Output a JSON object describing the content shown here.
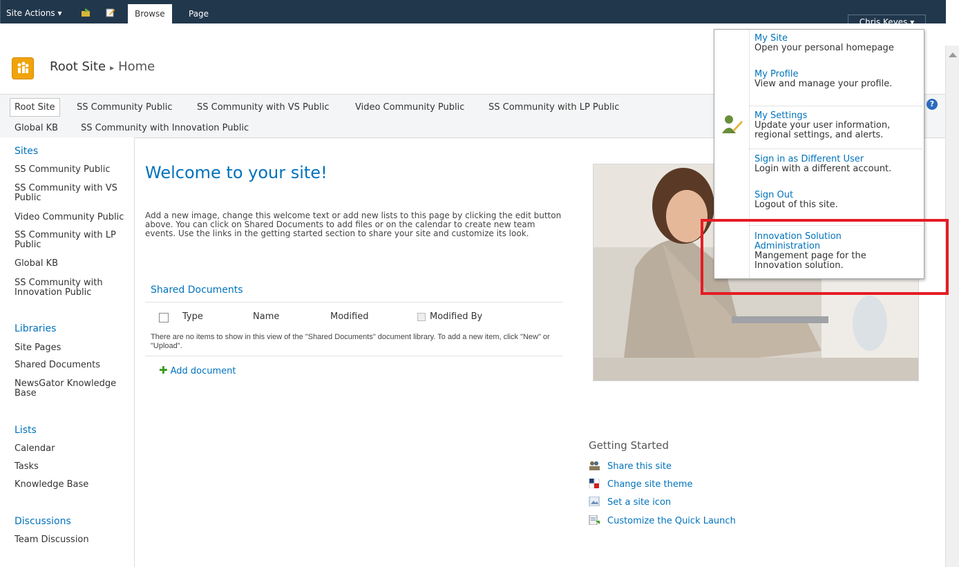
{
  "ribbon": {
    "site_actions": "Site Actions ▾",
    "tabs": [
      {
        "label": "Browse"
      },
      {
        "label": "Page"
      }
    ],
    "user": "Chris Keyes ▾"
  },
  "header": {
    "site": "Root Site",
    "current": "Home"
  },
  "topnav": {
    "row1": [
      "Root Site",
      "SS Community Public",
      "SS Community with VS Public",
      "Video Community Public",
      "SS Community with LP Public"
    ],
    "row2": [
      "Global KB",
      "SS Community with Innovation Public"
    ]
  },
  "quicklaunch": {
    "sites_heading": "Sites",
    "sites": [
      "SS Community Public",
      "SS Community with VS Public",
      "Video Community Public",
      "SS Community with LP Public",
      "Global KB",
      "SS Community with Innovation Public"
    ],
    "libraries_heading": "Libraries",
    "libraries": [
      "Site Pages",
      "Shared Documents",
      "NewsGator Knowledge Base"
    ],
    "lists_heading": "Lists",
    "lists": [
      "Calendar",
      "Tasks",
      "Knowledge Base"
    ],
    "discussions_heading": "Discussions",
    "discussions": [
      "Team Discussion"
    ]
  },
  "main": {
    "welcome_title": "Welcome to your site!",
    "welcome_text": "Add a new image, change this welcome text or add new lists to this page by clicking the edit button above. You can click on Shared Documents to add files or on the calendar to create new team events. Use the links in the getting started section to share your site and customize its look.",
    "shared_docs": {
      "title": "Shared Documents",
      "columns": [
        "Type",
        "Name",
        "Modified",
        "Modified By"
      ],
      "empty": "There are no items to show in this view of the \"Shared Documents\" document library. To add a new item, click \"New\" or \"Upload\".",
      "add": "Add document"
    },
    "getting_started": {
      "title": "Getting Started",
      "items": [
        "Share this site",
        "Change site theme",
        "Set a site icon",
        "Customize the Quick Launch"
      ]
    }
  },
  "user_menu": {
    "items": [
      {
        "title": "My Site",
        "desc": "Open your personal homepage"
      },
      {
        "title": "My Profile",
        "desc": "View and manage your profile."
      },
      {
        "title": "My Settings",
        "desc": "Update your user information, regional settings, and alerts."
      },
      {
        "title": "Sign in as Different User",
        "desc": "Login with a different account."
      },
      {
        "title": "Sign Out",
        "desc": "Logout of this site."
      },
      {
        "title": "Innovation Solution Administration",
        "desc": "Mangement page for the Innovation solution."
      }
    ]
  },
  "colors": {
    "ribbon": "#21374c",
    "link": "#0072bc",
    "highlight": "#e51c24"
  }
}
